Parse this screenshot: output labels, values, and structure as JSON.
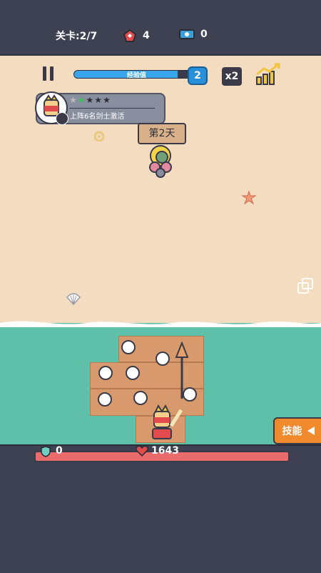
{
  "topbar": {
    "level_label": "关卡:2/7",
    "gems": "4",
    "tickets": "0"
  },
  "xp": {
    "label": "经验值",
    "level": "2",
    "progress": 0.85
  },
  "speed": {
    "label": "x2"
  },
  "hero_unlock": {
    "stars_total": 5,
    "stars_filled": 1,
    "description": "上阵6名剑士激活"
  },
  "day_sign": "第2天",
  "skill_button": {
    "label": "技能"
  },
  "status": {
    "shield": "0",
    "hp": "1643"
  },
  "colors": {
    "sea": "#5fc0aa",
    "beach": "#f4dcc0",
    "xp_fill": "#38a6e8",
    "hp_bar": "#e96b6b",
    "skill_button": "#f08a2c"
  }
}
